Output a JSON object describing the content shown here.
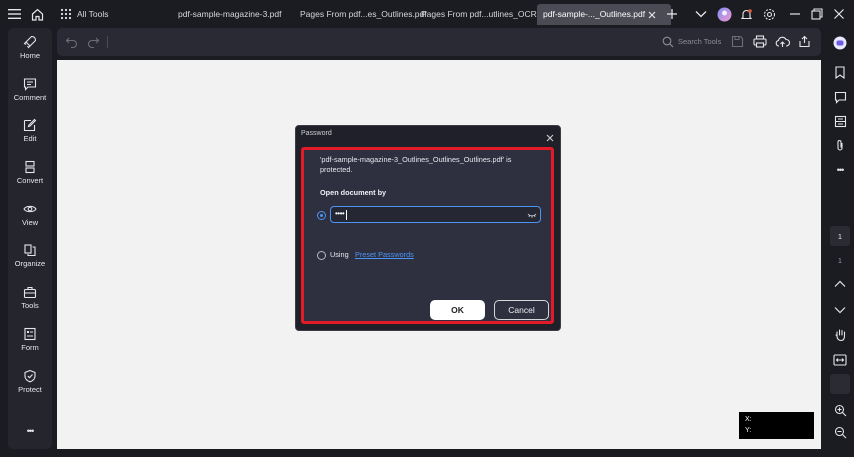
{
  "titlebar": {
    "all_tools_label": "All Tools",
    "tabs": [
      {
        "label": "pdf-sample-magazine-3.pdf"
      },
      {
        "label": "Pages From pdf...es_Outlines.pdf"
      },
      {
        "label": "Pages From pdf...utlines_OCR.pdf"
      },
      {
        "label": "pdf-sample-..._Outlines.pdf"
      }
    ]
  },
  "left_nav": {
    "items": [
      {
        "label": "Home",
        "icon": "rocket-icon"
      },
      {
        "label": "Comment",
        "icon": "comment-icon"
      },
      {
        "label": "Edit",
        "icon": "edit-icon"
      },
      {
        "label": "Convert",
        "icon": "convert-icon"
      },
      {
        "label": "View",
        "icon": "eye-icon"
      },
      {
        "label": "Organize",
        "icon": "organize-icon"
      },
      {
        "label": "Tools",
        "icon": "toolbox-icon"
      },
      {
        "label": "Form",
        "icon": "form-icon"
      },
      {
        "label": "Protect",
        "icon": "shield-icon"
      }
    ],
    "more_label": "•••"
  },
  "toolbar": {
    "search_label": "Search Tools"
  },
  "right_rail": {
    "page_current": "1",
    "page_total": "1"
  },
  "dialog": {
    "title": "Password",
    "message": "'pdf-sample-magazine-3_Outlines_Outlines_Outlines.pdf' is protected.",
    "open_by_label": "Open document by",
    "password_value": "••••",
    "using_label": "Using",
    "preset_link": "Preset Passwords",
    "ok_label": "OK",
    "cancel_label": "Cancel"
  },
  "coordinates": {
    "x_label": "X:",
    "y_label": "Y:"
  },
  "colors": {
    "accent": "#4d95f2",
    "highlight": "#e31a27"
  }
}
